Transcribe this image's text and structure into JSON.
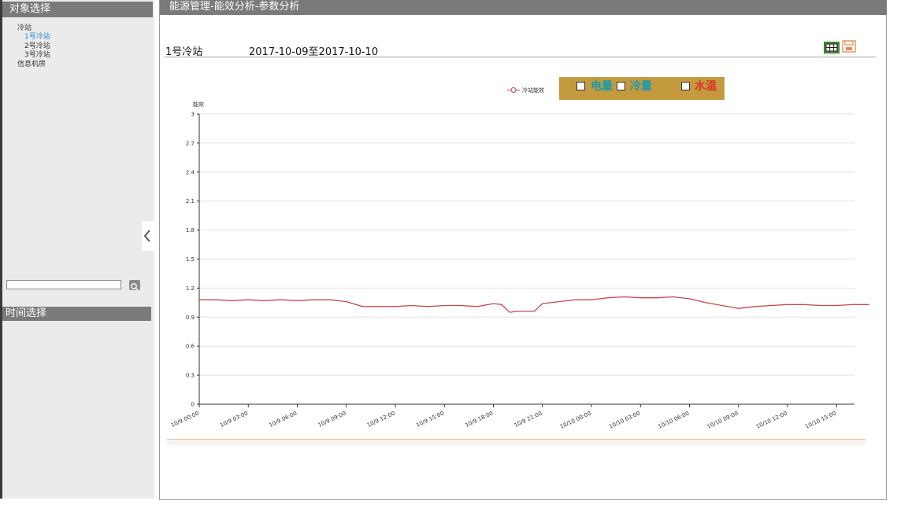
{
  "sidebar": {
    "object_header": "对象选择",
    "tree": [
      {
        "label": "冷站",
        "active": false
      },
      {
        "label": "1号冷站",
        "active": true
      },
      {
        "label": "2号冷站",
        "active": false
      },
      {
        "label": "3号冷站",
        "active": false
      },
      {
        "label": "信息机房",
        "active": false
      }
    ],
    "search": {
      "value": "",
      "placeholder": ""
    },
    "time_header": "时间选择"
  },
  "main": {
    "title": "能源管理-能效分析-参数分析",
    "station": "1号冷站",
    "date_range": "2017-10-09至2017-10-10"
  },
  "filters": [
    {
      "label": "电量",
      "color": "#1a9aaa",
      "checked": false
    },
    {
      "label": "冷量",
      "color": "#1a9aaa",
      "checked": false
    },
    {
      "label": "水温",
      "color": "#d8352a",
      "checked": false
    }
  ],
  "colors": {
    "header_bg": "#7a7a7a",
    "sidebar_bg": "#ebebeb",
    "active_item": "#1e88c8",
    "filter_bg": "#c49a3e",
    "series_line": "#c9484a"
  },
  "icons": {
    "table": "table-icon",
    "save": "save-icon",
    "search": "search-icon",
    "collapse": "chevron-left-icon"
  },
  "chart_data": {
    "type": "line",
    "ylabel": "能效",
    "xlabel": "",
    "ylim": [
      0,
      3
    ],
    "yticks": [
      "0",
      "0.3",
      "0.6",
      "0.9",
      "1.2",
      "1.5",
      "1.8",
      "2.1",
      "2.4",
      "2.7",
      "3"
    ],
    "xticks": [
      "10/9 00:00",
      "10/9 03:00",
      "10/9 06:00",
      "10/9 09:00",
      "10/9 12:00",
      "10/9 15:00",
      "10/9 18:00",
      "10/9 21:00",
      "10/10 00:00",
      "10/10 03:00",
      "10/10 06:00",
      "10/10 09:00",
      "10/10 12:00",
      "10/10 15:00"
    ],
    "grid": true,
    "legend_position": "top-center",
    "series": [
      {
        "name": "冷站能效",
        "color": "#c9484a",
        "x_hours": [
          0,
          1,
          2,
          3,
          4,
          5,
          6,
          7,
          8,
          9,
          10,
          11,
          12,
          13,
          14,
          15,
          16,
          17,
          18,
          18.5,
          19,
          19.5,
          20,
          20.5,
          21,
          22,
          23,
          24,
          25,
          26,
          27,
          28,
          29,
          30,
          31,
          32,
          33,
          34,
          35,
          36,
          37,
          38,
          39,
          40,
          41
        ],
        "values": [
          1.08,
          1.08,
          1.07,
          1.08,
          1.07,
          1.08,
          1.07,
          1.08,
          1.08,
          1.06,
          1.01,
          1.01,
          1.01,
          1.02,
          1.01,
          1.02,
          1.02,
          1.01,
          1.04,
          1.03,
          0.95,
          0.96,
          0.96,
          0.96,
          1.04,
          1.06,
          1.08,
          1.08,
          1.1,
          1.11,
          1.1,
          1.1,
          1.11,
          1.09,
          1.05,
          1.02,
          0.99,
          1.01,
          1.02,
          1.03,
          1.03,
          1.02,
          1.02,
          1.03,
          1.03
        ]
      }
    ]
  }
}
